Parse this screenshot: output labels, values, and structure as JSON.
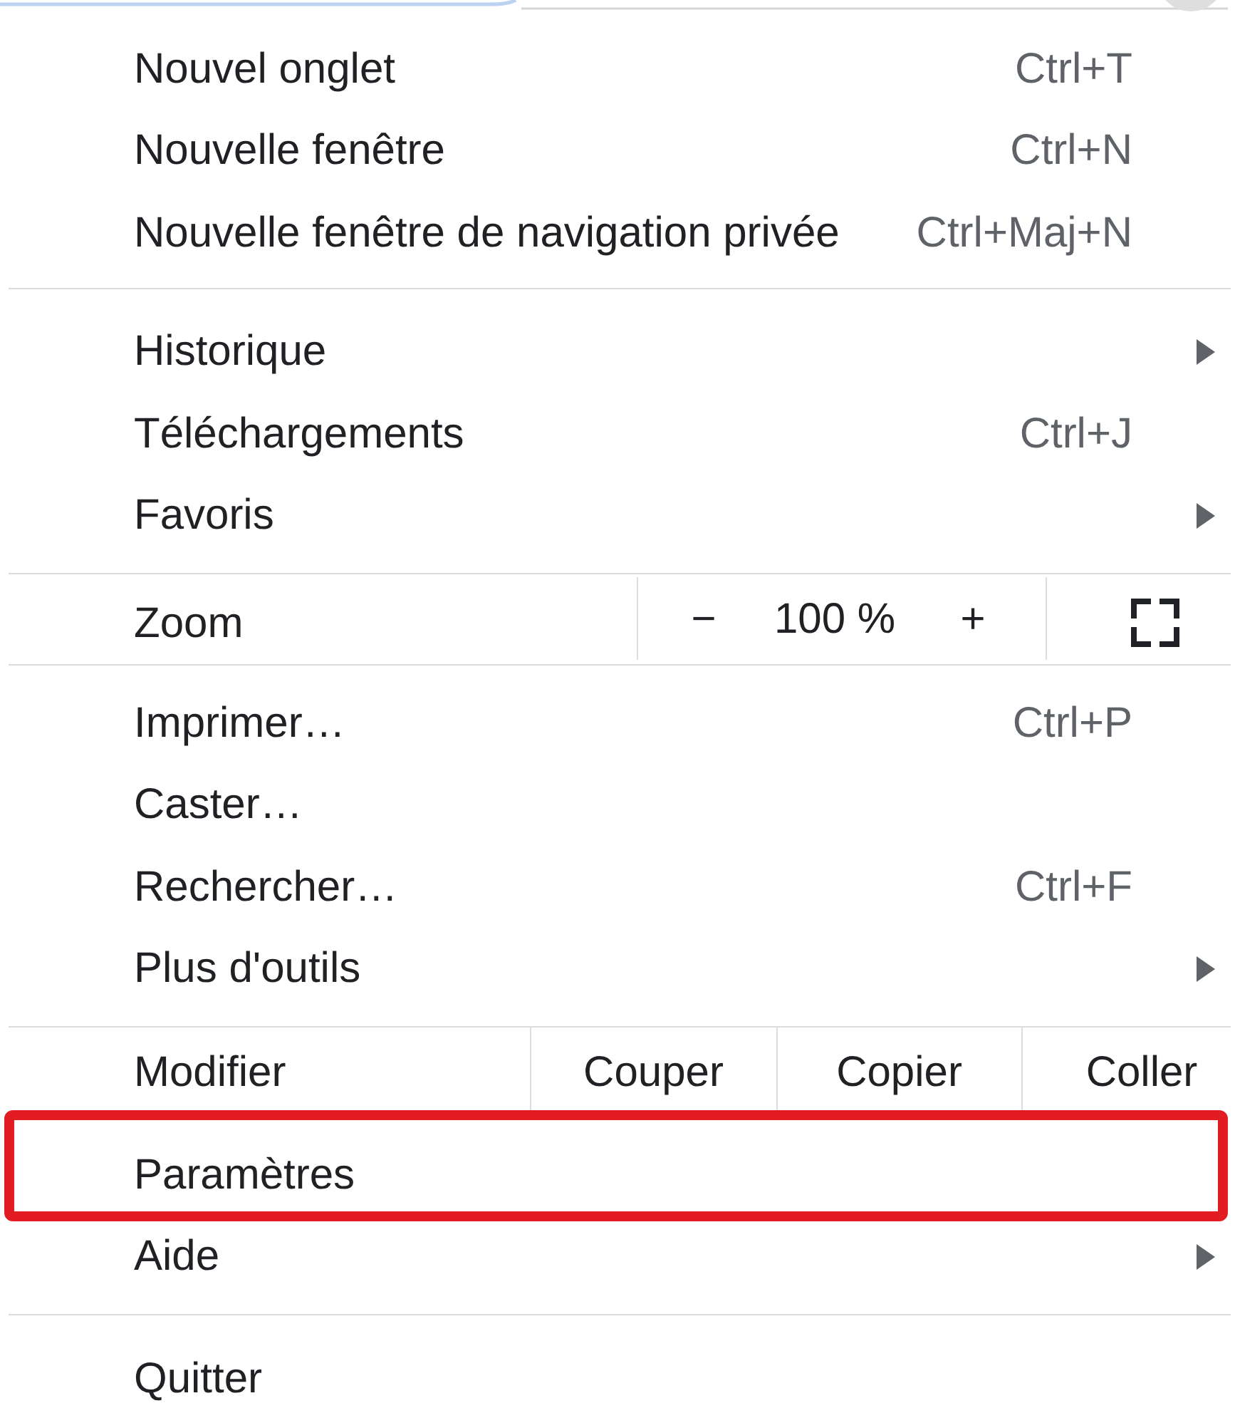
{
  "menu": {
    "sections": [
      {
        "items": [
          {
            "kind": "item",
            "label": "Nouvel onglet",
            "shortcut": "Ctrl+T",
            "submenu": false,
            "highlighted": false
          },
          {
            "kind": "item",
            "label": "Nouvelle fenêtre",
            "shortcut": "Ctrl+N",
            "submenu": false,
            "highlighted": false
          },
          {
            "kind": "item",
            "label": "Nouvelle fenêtre de navigation privée",
            "shortcut": "Ctrl+Maj+N",
            "submenu": false,
            "highlighted": false
          }
        ]
      },
      {
        "items": [
          {
            "kind": "item",
            "label": "Historique",
            "submenu": true,
            "highlighted": false
          },
          {
            "kind": "item",
            "label": "Téléchargements",
            "shortcut": "Ctrl+J",
            "submenu": false,
            "highlighted": false
          },
          {
            "kind": "item",
            "label": "Favoris",
            "submenu": true,
            "highlighted": false
          }
        ]
      },
      {
        "items": [
          {
            "kind": "zoom",
            "label": "Zoom",
            "decrease": "−",
            "value": "100 %",
            "increase": "+",
            "highlighted": false
          }
        ]
      },
      {
        "items": [
          {
            "kind": "item",
            "label": "Imprimer…",
            "shortcut": "Ctrl+P",
            "submenu": false,
            "highlighted": false
          },
          {
            "kind": "item",
            "label": "Caster…",
            "submenu": false,
            "highlighted": false
          },
          {
            "kind": "item",
            "label": "Rechercher…",
            "shortcut": "Ctrl+F",
            "submenu": false,
            "highlighted": false
          },
          {
            "kind": "item",
            "label": "Plus d'outils",
            "submenu": true,
            "highlighted": false
          }
        ]
      },
      {
        "items": [
          {
            "kind": "edit",
            "label": "Modifier",
            "actions": [
              "Couper",
              "Copier",
              "Coller"
            ],
            "highlighted": false
          },
          {
            "kind": "item",
            "label": "Paramètres",
            "submenu": false,
            "highlighted": true
          },
          {
            "kind": "item",
            "label": "Aide",
            "submenu": true,
            "highlighted": false
          }
        ]
      },
      {
        "items": [
          {
            "kind": "item",
            "label": "Quitter",
            "submenu": false,
            "highlighted": false
          }
        ]
      }
    ]
  }
}
